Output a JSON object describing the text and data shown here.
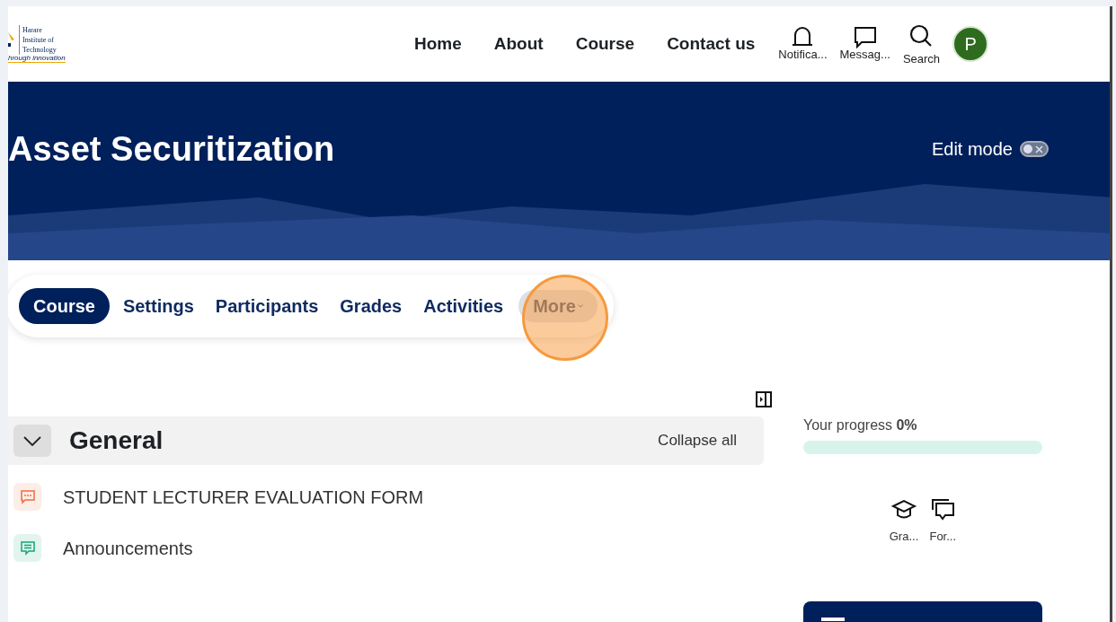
{
  "logo": {
    "name_lines": [
      "Harare",
      "Institute of",
      "Technology"
    ],
    "tagline": "hrough innovation"
  },
  "nav": {
    "links": [
      "Home",
      "About",
      "Course",
      "Contact us"
    ],
    "icons": [
      {
        "kind": "bell",
        "label": "Notifica..."
      },
      {
        "kind": "chat",
        "label": "Messag..."
      },
      {
        "kind": "search",
        "label": "Search"
      }
    ],
    "avatar": "P"
  },
  "banner": {
    "title": "Asset Securitization",
    "edit_mode": {
      "label": "Edit mode",
      "on": false
    }
  },
  "tabs": [
    {
      "label": "Course",
      "selected": true
    },
    {
      "label": "Settings",
      "selected": false
    },
    {
      "label": "Participants",
      "selected": false
    },
    {
      "label": "Grades",
      "selected": false
    },
    {
      "label": "Activities",
      "selected": false
    },
    {
      "label": "More",
      "selected": false,
      "dropdown": true
    }
  ],
  "section": {
    "title": "General",
    "expanded": true,
    "collapse_all": "Collapse all",
    "activities": [
      {
        "kind": "feedback",
        "title": "STUDENT LECTURER EVALUATION FORM",
        "color": "#f26b3a"
      },
      {
        "kind": "forum",
        "title": "Announcements",
        "color": "#11a676"
      }
    ]
  },
  "sidebar": {
    "progress": {
      "label": "Your progress **0%**",
      "level": 0
    },
    "shortcuts": [
      {
        "kind": "grades",
        "label": "Gra..."
      },
      {
        "kind": "forum",
        "label": "For..."
      }
    ]
  }
}
